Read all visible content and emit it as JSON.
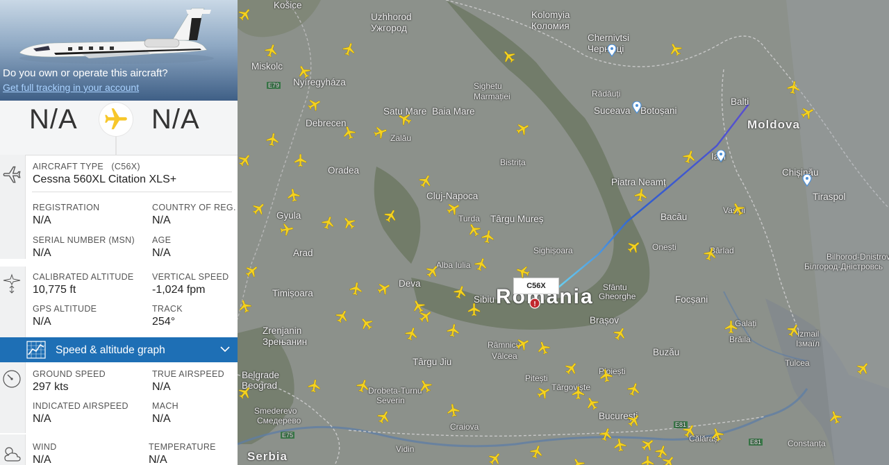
{
  "hero": {
    "own_question": "Do you own or operate this aircraft?",
    "own_link": "Get full tracking in your account"
  },
  "route": {
    "origin": "N/A",
    "destination": "N/A",
    "plane_icon_color": "#f7c72a"
  },
  "aircraft": {
    "type_label": "AIRCRAFT TYPE",
    "type_code": "(C56X)",
    "type_name": "Cessna 560XL Citation XLS+",
    "registration_label": "REGISTRATION",
    "registration": "N/A",
    "country_label": "COUNTRY OF REG.",
    "country": "N/A",
    "msn_label": "SERIAL NUMBER (MSN)",
    "msn": "N/A",
    "age_label": "AGE",
    "age": "N/A"
  },
  "altitude": {
    "cal_alt_label": "CALIBRATED ALTITUDE",
    "cal_alt": "10,775 ft",
    "vspeed_label": "VERTICAL SPEED",
    "vspeed": "-1,024 fpm",
    "gps_alt_label": "GPS ALTITUDE",
    "gps_alt": "N/A",
    "track_label": "TRACK",
    "track": "254°"
  },
  "graph_bar": {
    "label": "Speed & altitude graph",
    "color": "#1e6fb5"
  },
  "speed": {
    "ground_label": "GROUND SPEED",
    "ground": "297 kts",
    "tas_label": "TRUE AIRSPEED",
    "tas": "N/A",
    "ias_label": "INDICATED AIRSPEED",
    "ias": "N/A",
    "mach_label": "MACH",
    "mach": "N/A"
  },
  "weather": {
    "wind_label": "WIND",
    "wind": "N/A",
    "temp_label": "TEMPERATURE",
    "temp": "N/A"
  },
  "map": {
    "selected_callsign": "C56X",
    "country_labels": {
      "romania": "Romania",
      "moldova": "Moldova",
      "serbia": "Serbia"
    },
    "cities": {
      "kosice": "Košice",
      "uzhhorod": "Uzhhorod",
      "uzhhorod_cyr": "Ужгород",
      "kolomyia": "Kolomyia",
      "kolomyia_cyr": "Коломия",
      "chernivtsi": "Chernivtsi",
      "chernivtsi_cyr": "Чернівці",
      "miskolc": "Miskolc",
      "nyiregyhaza": "Nyíregyháza",
      "sighetu": "Sighetu",
      "marmatiei": "Marmației",
      "radauti": "Rădăuți",
      "suceava": "Suceava",
      "botosani": "Botoșani",
      "balti": "Balti",
      "satu_mare": "Satu Mare",
      "baia_mare": "Baia Mare",
      "debrecen": "Debrecen",
      "zalau": "Zalău",
      "bistrita": "Bistrița",
      "oradea": "Oradea",
      "piatra_neamt": "Piatra Neamț",
      "iasi": "Iași",
      "chisinau": "Chișinău",
      "cluj": "Cluj-Napoca",
      "tiraspol": "Tiraspol",
      "gyula": "Gyula",
      "turda": "Turda",
      "targu_mures": "Târgu Mureș",
      "bacau": "Bacău",
      "vaslui": "Vaslui",
      "arad": "Arad",
      "sighisoara": "Sighișoara",
      "onesti": "Onești",
      "barlad": "Bârlad",
      "bilhorod": "Bilhorod-Dnistrovs",
      "bilhorod_cyr": "Білгород-Дністровсь",
      "alba_iulia": "Alba Iulia",
      "deva": "Deva",
      "timisoara": "Timișoara",
      "sibiu": "Sibiu",
      "sfantu": "Sfântu",
      "gheorghe": "Gheorghe",
      "focsani": "Focșani",
      "zrenjanin": "Zrenjanin",
      "zrenjanin_cyr": "Зрењанин",
      "brasov": "Brașov",
      "galati": "Galați",
      "braila": "Brăila",
      "izmail": "Izmail",
      "izmail_cyr": "Ізмаїл",
      "ramnicu": "Râmnicu",
      "valcea": "Vâlcea",
      "buzau": "Buzău",
      "targu_jiu": "Târgu Jiu",
      "tulcea": "Tulcea",
      "belgrade": "Belgrade",
      "beograd": "Beograd",
      "pitesti": "Pitești",
      "ploiesti": "Ploiești",
      "targoviste": "Târgoviște",
      "drobeta": "Drobeta-Turnu",
      "severin": "Severin",
      "bucuresti": "București",
      "smederevo": "Smederevo",
      "smederevo_cyr": "Смедерево",
      "craiova": "Craiova",
      "calarasi": "Călărași",
      "constanta": "Constanța",
      "vidin": "Vidin"
    },
    "roads": {
      "e79": "E79",
      "e75": "E75",
      "e81": "E81",
      "e81b": "E81"
    },
    "accent_track_start": "#2f5fcf",
    "accent_track_end": "#6ad0f0",
    "aircraft_color": "#f5d21f"
  }
}
